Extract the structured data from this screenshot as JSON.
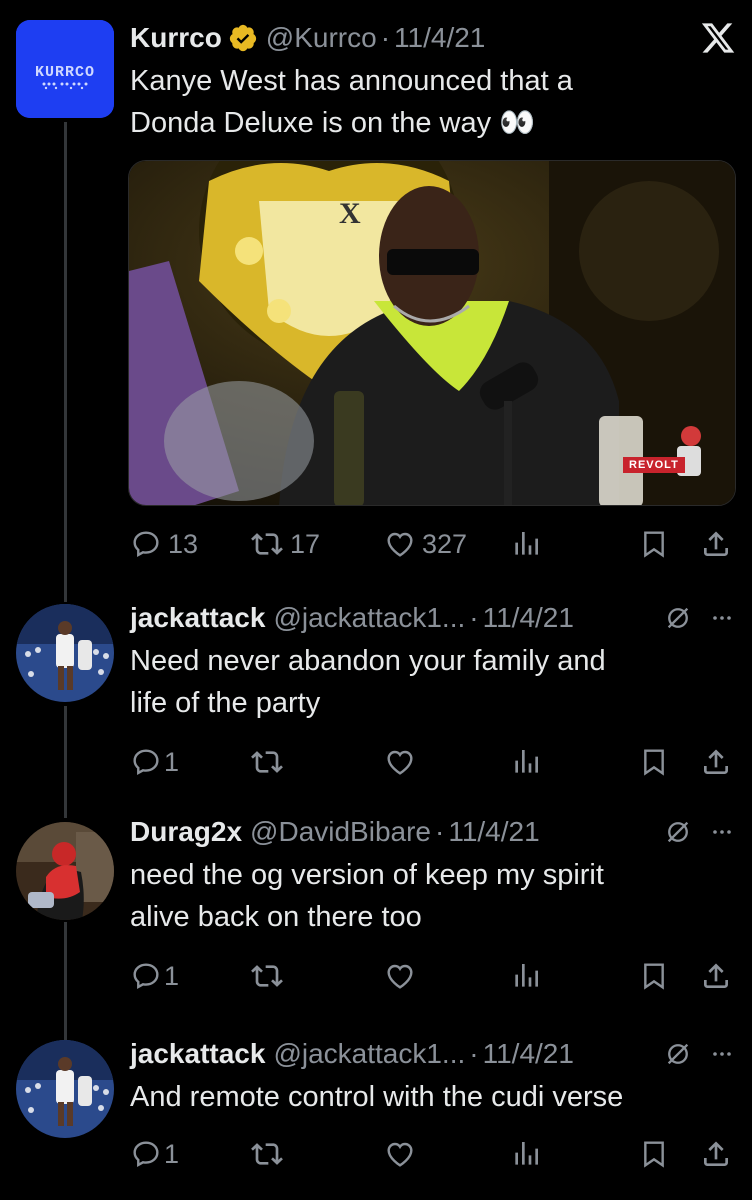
{
  "main_tweet": {
    "author_name": "Kurrco",
    "handle": "@Kurrco",
    "date": "11/4/21",
    "text_line1": "Kanye West has announced that a",
    "text_line2": "Donda Deluxe is on the way 👀",
    "avatar_text": "KURRCO",
    "media_watermark": "REVOLT",
    "platform_logo": "X",
    "replies": "13",
    "retweets": "17",
    "likes": "327"
  },
  "replies": [
    {
      "author_name": "jackattack",
      "handle": "@jackattack1...",
      "date": "11/4/21",
      "text_line1": "Need never abandon your family and",
      "text_line2": "life of the party",
      "reply_count": "1"
    },
    {
      "author_name": "Durag2x",
      "handle": "@DavidBibare",
      "date": "11/4/21",
      "text_line1": "need the og version of keep my spirit",
      "text_line2": "alive back on there too",
      "reply_count": "1"
    },
    {
      "author_name": "jackattack",
      "handle": "@jackattack1...",
      "date": "11/4/21",
      "text_line1": "And remote control with the cudi verse",
      "reply_count": "1"
    }
  ],
  "colors": {
    "background": "#000000",
    "text": "#e7e9ea",
    "secondary": "#8b9199",
    "verified_gold": "#e8b923",
    "kurrco_blue": "#1c3cf0"
  },
  "separator": "·"
}
